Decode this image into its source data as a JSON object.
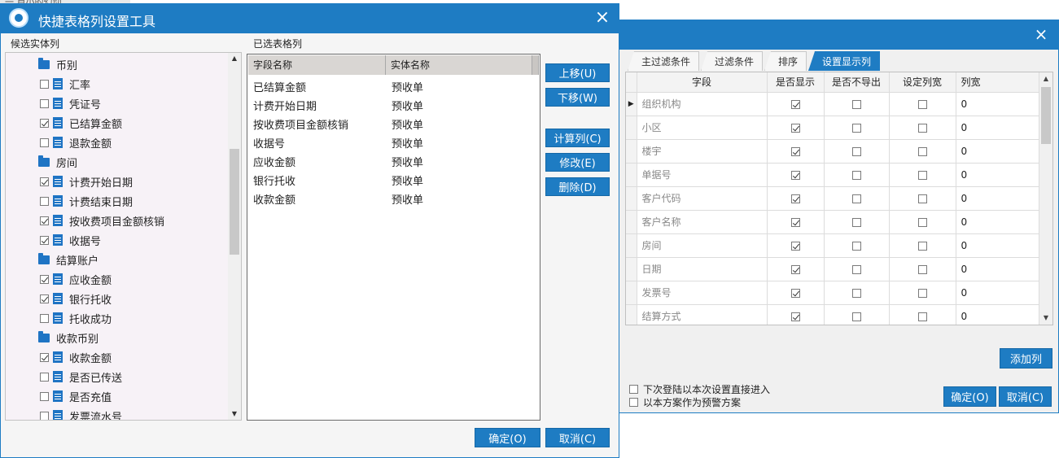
{
  "background": {
    "title_fragment": "一 卢小的幻动"
  },
  "left_dialog": {
    "title": "快捷表格列设置工具",
    "close": "×",
    "candidate_label": "候选实体列",
    "selected_label": "已选表格列",
    "tree": [
      {
        "type": "folder",
        "label": "币别"
      },
      {
        "type": "field",
        "label": "汇率",
        "checked": false
      },
      {
        "type": "field",
        "label": "凭证号",
        "checked": false
      },
      {
        "type": "field",
        "label": "已结算金额",
        "checked": true
      },
      {
        "type": "field",
        "label": "退款金额",
        "checked": false
      },
      {
        "type": "folder",
        "label": "房间"
      },
      {
        "type": "field",
        "label": "计费开始日期",
        "checked": true
      },
      {
        "type": "field",
        "label": "计费结束日期",
        "checked": false
      },
      {
        "type": "field",
        "label": "按收费项目金额核销",
        "checked": true
      },
      {
        "type": "field",
        "label": "收据号",
        "checked": true
      },
      {
        "type": "folder",
        "label": "结算账户"
      },
      {
        "type": "field",
        "label": "应收金额",
        "checked": true
      },
      {
        "type": "field",
        "label": "银行托收",
        "checked": true
      },
      {
        "type": "field",
        "label": "托收成功",
        "checked": false
      },
      {
        "type": "folder",
        "label": "收款币别"
      },
      {
        "type": "field",
        "label": "收款金额",
        "checked": true
      },
      {
        "type": "field",
        "label": "是否已传送",
        "checked": false
      },
      {
        "type": "field",
        "label": "是否充值",
        "checked": false
      },
      {
        "type": "field",
        "label": "发票流水号",
        "checked": false
      }
    ],
    "selected_columns": {
      "headers": [
        "字段名称",
        "实体名称"
      ],
      "rows": [
        [
          "已结算金额",
          "预收单"
        ],
        [
          "计费开始日期",
          "预收单"
        ],
        [
          "按收费项目金额核销",
          "预收单"
        ],
        [
          "收据号",
          "预收单"
        ],
        [
          "应收金额",
          "预收单"
        ],
        [
          "银行托收",
          "预收单"
        ],
        [
          "收款金额",
          "预收单"
        ]
      ]
    },
    "buttons": {
      "move_up": "上移(U)",
      "move_down": "下移(W)",
      "calc_col": "计算列(C)",
      "modify": "修改(E)",
      "delete": "删除(D)",
      "ok": "确定(O)",
      "cancel": "取消(C)"
    }
  },
  "right_dialog": {
    "close": "×",
    "tabs": [
      "主过滤条件",
      "过滤条件",
      "排序",
      "设置显示列"
    ],
    "active_tab": 3,
    "grid": {
      "headers": [
        "字段",
        "是否显示",
        "是否不导出",
        "设定列宽",
        "列宽"
      ],
      "current_row_marker": "▶",
      "rows": [
        {
          "field": "组织机构",
          "show": true,
          "no_export": false,
          "set_width": false,
          "width": "0"
        },
        {
          "field": "小区",
          "show": true,
          "no_export": false,
          "set_width": false,
          "width": "0"
        },
        {
          "field": "楼宇",
          "show": true,
          "no_export": false,
          "set_width": false,
          "width": "0"
        },
        {
          "field": "单据号",
          "show": true,
          "no_export": false,
          "set_width": false,
          "width": "0"
        },
        {
          "field": "客户代码",
          "show": true,
          "no_export": false,
          "set_width": false,
          "width": "0"
        },
        {
          "field": "客户名称",
          "show": true,
          "no_export": false,
          "set_width": false,
          "width": "0"
        },
        {
          "field": "房间",
          "show": true,
          "no_export": false,
          "set_width": false,
          "width": "0"
        },
        {
          "field": "日期",
          "show": true,
          "no_export": false,
          "set_width": false,
          "width": "0"
        },
        {
          "field": "发票号",
          "show": true,
          "no_export": false,
          "set_width": false,
          "width": "0"
        },
        {
          "field": "结算方式",
          "show": true,
          "no_export": false,
          "set_width": false,
          "width": "0"
        }
      ]
    },
    "add_column": "添加列",
    "options": [
      {
        "label": "下次登陆以本次设置直接进入",
        "checked": false
      },
      {
        "label": "以本方案作为预警方案",
        "checked": false
      }
    ],
    "ok": "确定(O)",
    "cancel": "取消(C)"
  },
  "colors": {
    "accent": "#1e7cc3",
    "tree_bg": "#f7f2f7"
  }
}
